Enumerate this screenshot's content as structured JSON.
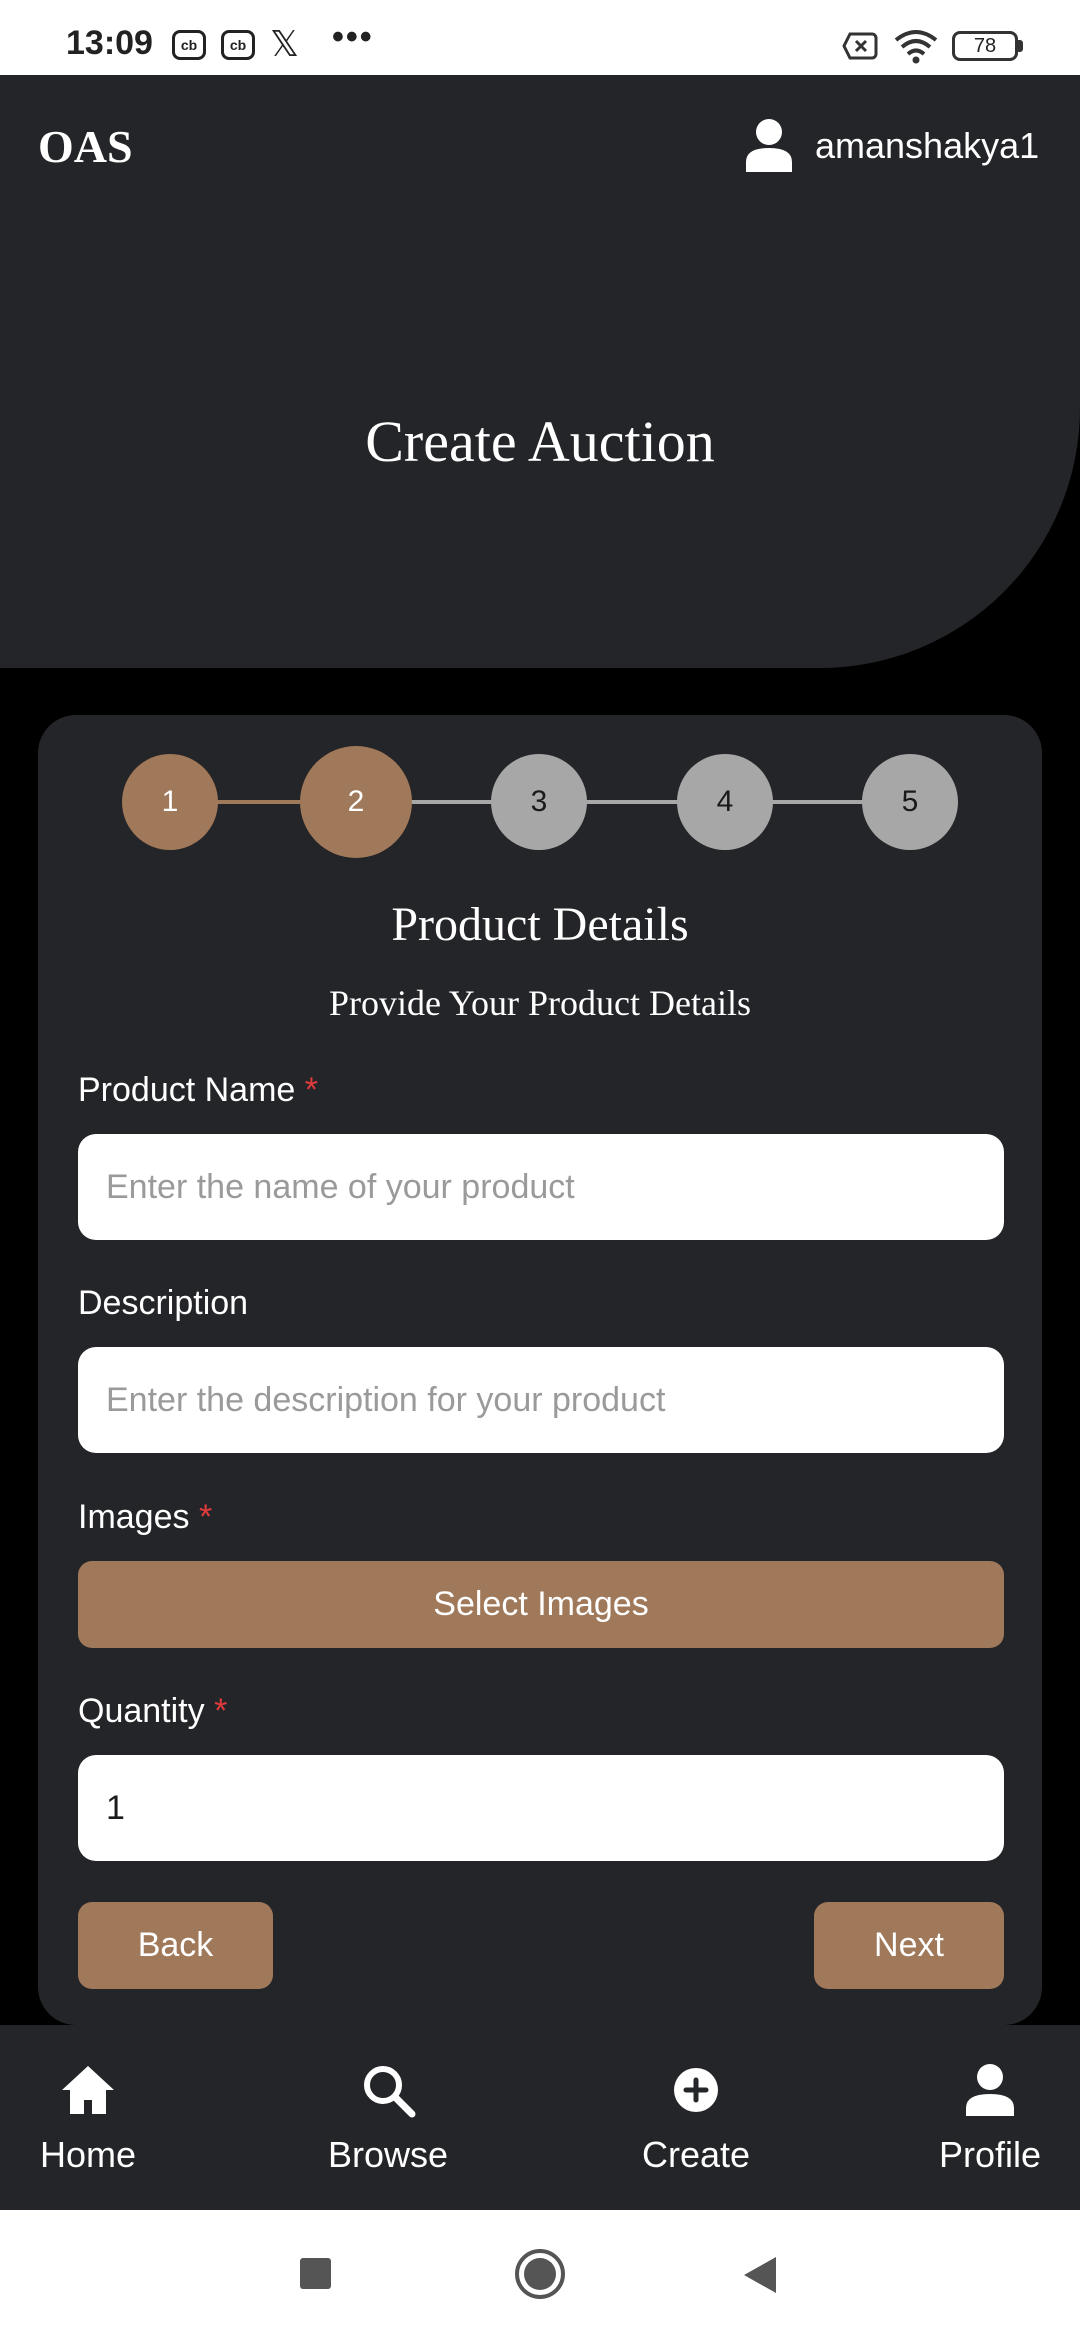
{
  "status_bar": {
    "time": "13:09",
    "notif_icon_1": "cb",
    "notif_icon_2": "cb",
    "notif_icon_3": "x-logo-icon",
    "more": "•••",
    "battery": "78"
  },
  "header": {
    "brand": "OAS",
    "username": "amanshakya1",
    "title": "Create Auction"
  },
  "stepper": {
    "steps": [
      "1",
      "2",
      "3",
      "4",
      "5"
    ],
    "current_step": 2
  },
  "section": {
    "title": "Product Details",
    "subtitle": "Provide Your Product Details"
  },
  "form": {
    "product_name": {
      "label": "Product Name",
      "required": "*",
      "placeholder": "Enter the name of your product",
      "value": ""
    },
    "description": {
      "label": "Description",
      "placeholder": "Enter the description for your product",
      "value": ""
    },
    "images": {
      "label": "Images",
      "required": "*",
      "button": "Select Images"
    },
    "quantity": {
      "label": "Quantity",
      "required": "*",
      "value": "1"
    }
  },
  "actions": {
    "back": "Back",
    "next": "Next"
  },
  "bottom_nav": {
    "items": [
      {
        "label": "Home",
        "icon": "home-icon"
      },
      {
        "label": "Browse",
        "icon": "search-icon"
      },
      {
        "label": "Create",
        "icon": "plus-circle-icon"
      },
      {
        "label": "Profile",
        "icon": "user-icon"
      }
    ]
  },
  "colors": {
    "accent": "#a0785a",
    "surface": "#242528",
    "background": "#000000",
    "required": "#e23b3b",
    "step_inactive": "#a7a7a7"
  }
}
